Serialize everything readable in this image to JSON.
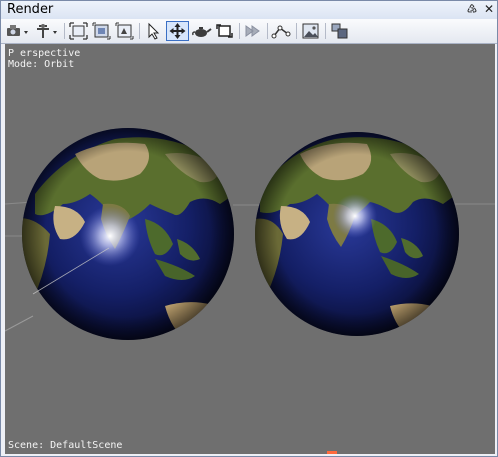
{
  "window": {
    "title": "Render"
  },
  "title_buttons": {
    "pin_glyph": "♵",
    "close_glyph": "✕"
  },
  "viewport": {
    "projection": "P erspective",
    "mode": "Mode: Orbit",
    "scene": "Scene: DefaultScene",
    "background": "#6f6f6f"
  },
  "toolbar_icons": [
    "camera-dropdown-icon",
    "light-dropdown-icon",
    "zoom-extents-icon",
    "zoom-region-icon",
    "zoom-selected-icon",
    "select-arrow-icon",
    "orbit-move-icon",
    "render-teapot-icon",
    "render-frame-icon",
    "render-region-icon",
    "curve-tool-icon",
    "image-icon",
    "layout-icon"
  ],
  "colors": {
    "accent": "#3a6fc4",
    "ocean": "#0e1854",
    "land_green": "#4e6a2a",
    "land_tan": "#b9a47a"
  }
}
